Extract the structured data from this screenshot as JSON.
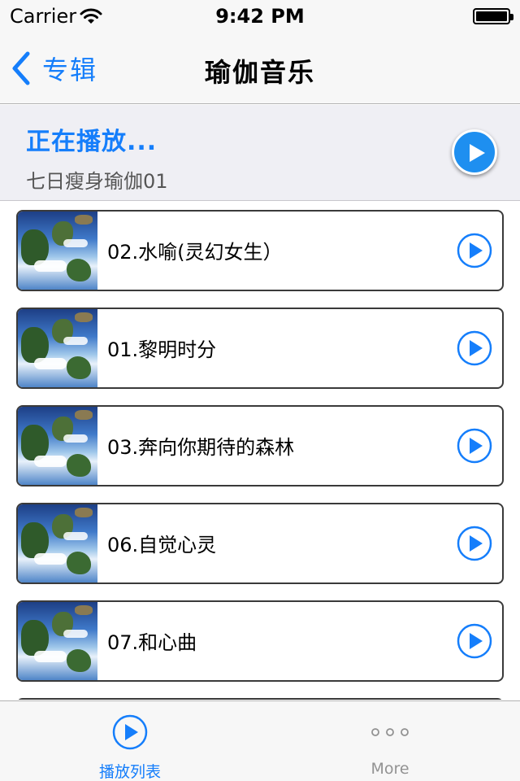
{
  "status_bar": {
    "carrier": "Carrier",
    "time": "9:42 PM",
    "battery_level": 1.0
  },
  "nav": {
    "back_label": "专辑",
    "title": "瑜伽音乐"
  },
  "now_playing": {
    "heading": "正在播放...",
    "track": "七日瘦身瑜伽01"
  },
  "tracks": [
    {
      "title": "02.水喻(灵幻女生）"
    },
    {
      "title": "01.黎明时分"
    },
    {
      "title": "03.奔向你期待的森林"
    },
    {
      "title": "06.自觉心灵"
    },
    {
      "title": "07.和心曲"
    }
  ],
  "tab_bar": {
    "tabs": [
      {
        "label": "播放列表",
        "icon": "play-circle-icon",
        "selected": true
      },
      {
        "label": "More",
        "icon": "more-dots-icon",
        "selected": false
      }
    ]
  },
  "colors": {
    "accent": "#157efb",
    "play_fill": "#1e8ff0",
    "bar_background": "#f7f7f7",
    "inactive_tab": "#929292"
  }
}
